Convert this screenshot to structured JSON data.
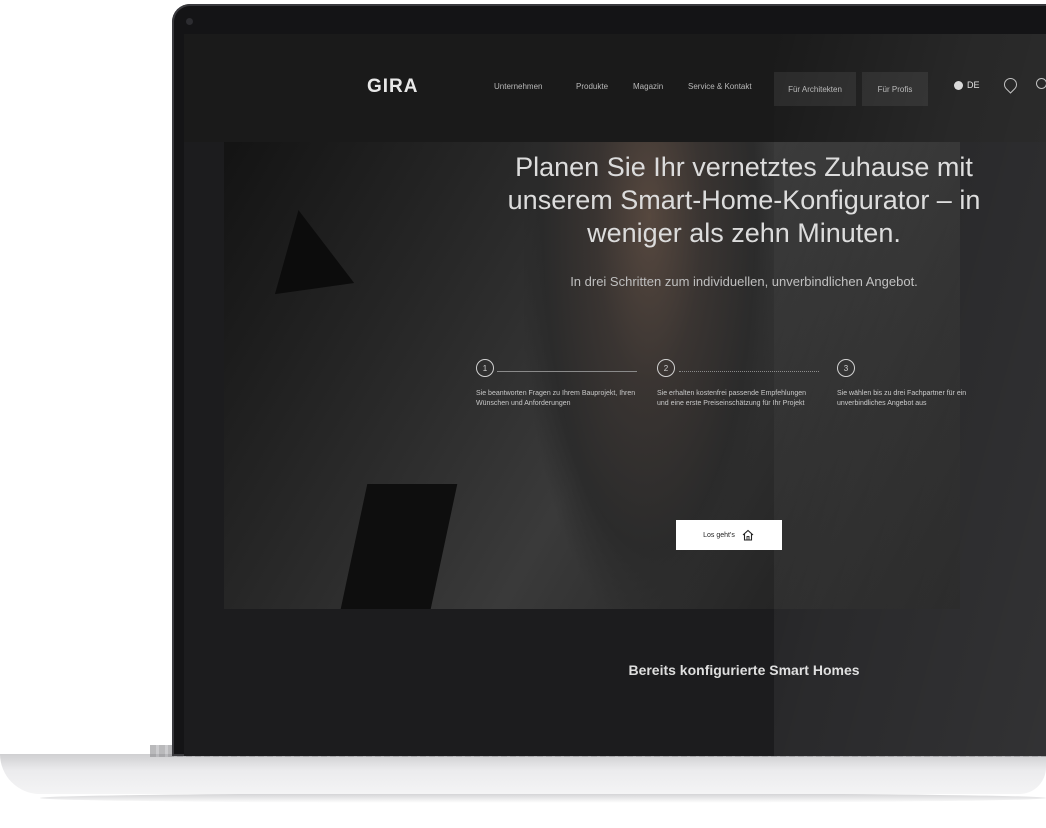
{
  "nav": {
    "logo": "GIRA",
    "items": [
      "Unternehmen",
      "Produkte",
      "Magazin",
      "Service & Kontakt"
    ],
    "buttons": [
      "Für Architekten",
      "Für Profis"
    ],
    "language": "DE"
  },
  "hero": {
    "headline": "Planen Sie Ihr vernetztes Zuhause mit unserem Smart-Home-Konfigurator – in weniger als zehn Minuten.",
    "subline": "In drei Schritten zum individuellen, unverbindlichen Angebot.",
    "steps": [
      {
        "number": "1",
        "text": "Sie beantworten Fragen zu Ihrem Bauprojekt, Ihren Wünschen und Anforderungen"
      },
      {
        "number": "2",
        "text": "Sie erhalten kostenfrei passende Empfehlungen und eine erste Preiseinschätzung für Ihr Projekt"
      },
      {
        "number": "3",
        "text": "Sie wählen bis zu drei Fachpartner für ein unverbindliches Angebot aus"
      }
    ],
    "cta_label": "Los geht's"
  },
  "section": {
    "title": "Bereits konfigurierte Smart Homes"
  },
  "icons": [
    "globe-icon",
    "location-pin-icon",
    "search-icon",
    "home-icon"
  ]
}
